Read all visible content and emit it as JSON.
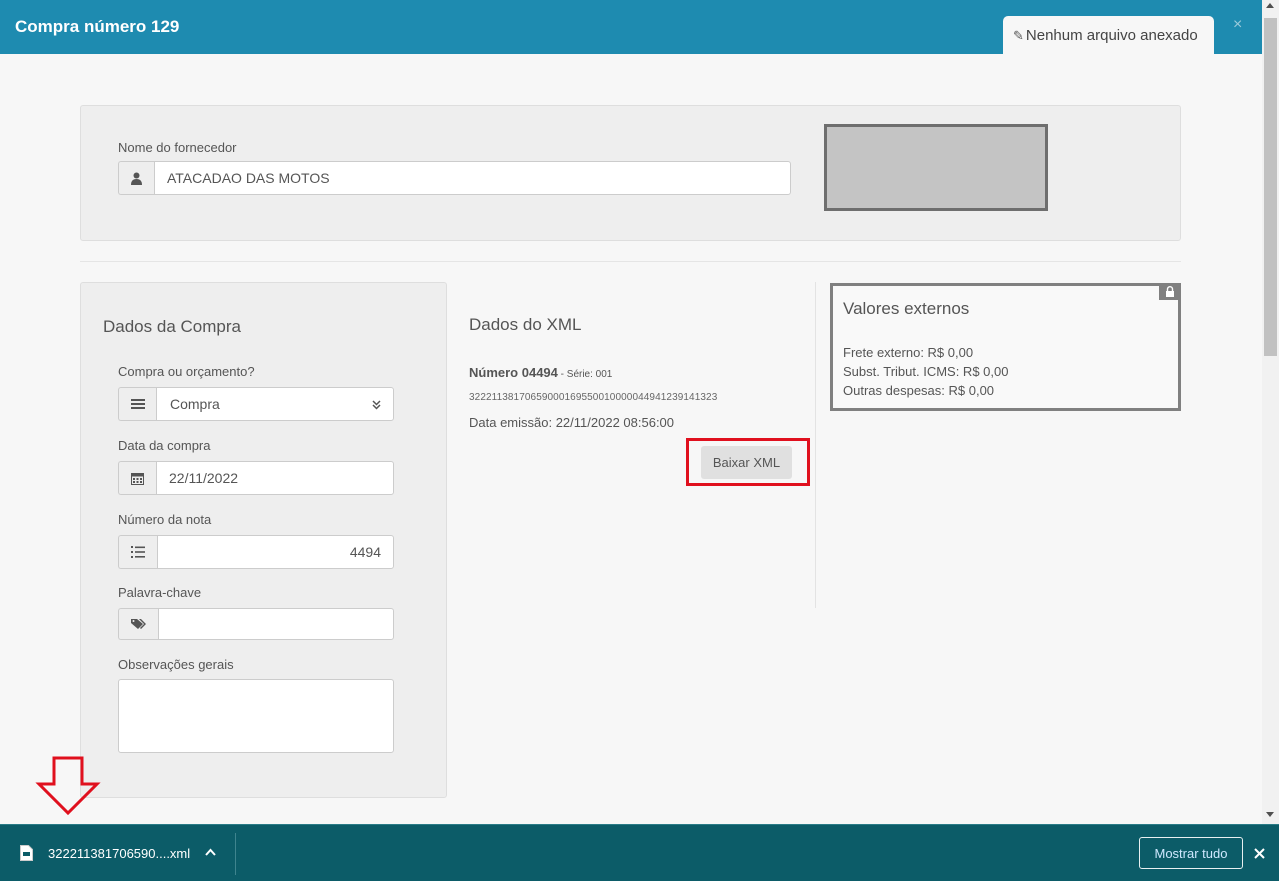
{
  "header": {
    "title": "Compra número 129",
    "attachment_label": "Nenhum arquivo anexado",
    "close_glyph": "×"
  },
  "supplier": {
    "label": "Nome do fornecedor",
    "value": "ATACADAO DAS MOTOS"
  },
  "purchase": {
    "title": "Dados da Compra",
    "type_label": "Compra ou orçamento?",
    "type_value": "Compra",
    "date_label": "Data da compra",
    "date_value": "22/11/2022",
    "invoice_label": "Número da nota",
    "invoice_value": "4494",
    "keyword_label": "Palavra-chave",
    "keyword_value": "",
    "notes_label": "Observações gerais",
    "notes_value": ""
  },
  "xml": {
    "title": "Dados do XML",
    "number": "Número 04494",
    "series": " - Série: 001",
    "key": "32221138170659000169550010000044941239141323",
    "emission": "Data emissão: 22/11/2022 08:56:00",
    "download_button": "Baixar XML"
  },
  "external_values": {
    "title": "Valores externos",
    "frete": "Frete externo: R$ 0,00",
    "icms": "Subst. Tribut. ICMS: R$ 0,00",
    "outras": "Outras despesas: R$ 0,00"
  },
  "download_bar": {
    "file_name": "322211381706590....xml",
    "show_all": "Mostrar tudo"
  },
  "colors": {
    "header": "#1e8bb0",
    "download_bar": "#0c5c68",
    "highlight": "#e0101e"
  }
}
